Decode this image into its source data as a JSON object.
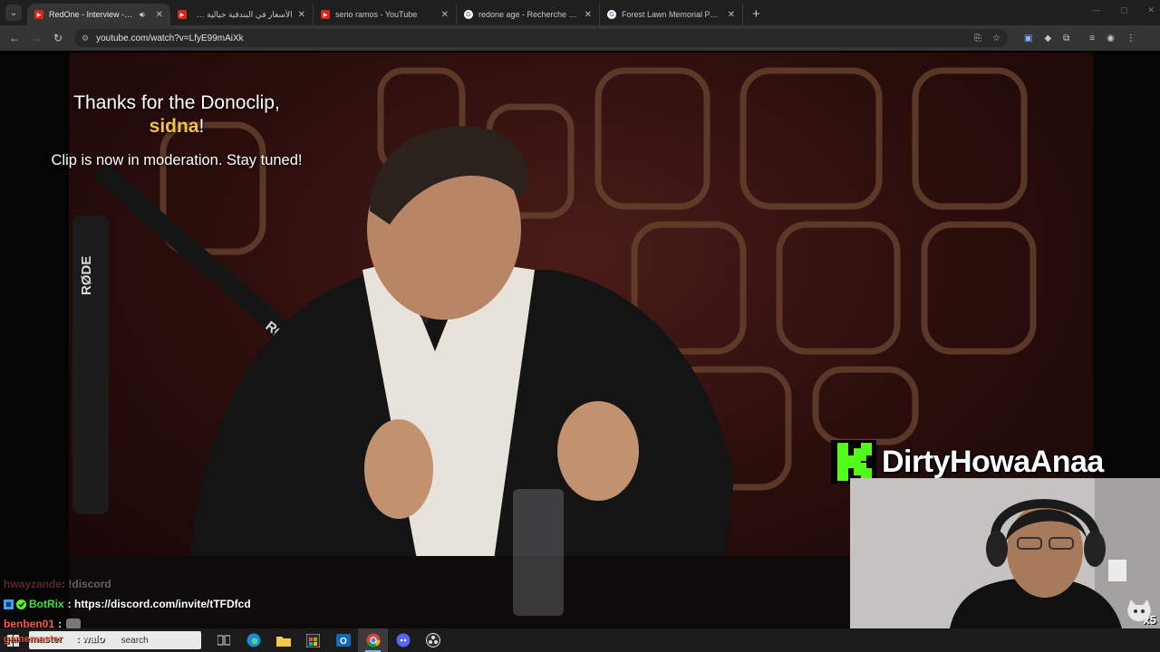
{
  "browser": {
    "tabs": [
      {
        "title": "RedOne - Interview - YouTube",
        "favicon": "youtube-icon",
        "active": true,
        "audio": true
      },
      {
        "title": "الأسعار في البندقية خيالية 🙂 جـ",
        "favicon": "youtube-icon",
        "active": false
      },
      {
        "title": "serio ramos - YouTube",
        "favicon": "youtube-icon",
        "active": false
      },
      {
        "title": "redone age - Recherche Google",
        "favicon": "google-icon",
        "active": false
      },
      {
        "title": "Forest Lawn Memorial Park – Google",
        "favicon": "google-icon",
        "active": false
      }
    ],
    "address": "youtube.com/watch?v=LfyE99mAiXk"
  },
  "overlay": {
    "donoclip_line1": "Thanks for the Donoclip,",
    "donoclip_name": "sidna",
    "donoclip_bang": "!",
    "donoclip_line2": "Clip is now in moderation. Stay tuned!",
    "streamer_name": "DirtyHowaAnaa",
    "emote_count": "x5"
  },
  "chat": [
    {
      "user": "hwayzande",
      "message": ": !discord",
      "faded": true
    },
    {
      "user": "BotRix",
      "message": ": https://discord.com/invite/tTFDfcd",
      "faded": false
    },
    {
      "user": "benben01",
      "message": ":",
      "faded": false
    },
    {
      "user": "gamemaster",
      "message": ": walo",
      "faded": false
    }
  ],
  "taskbar": {
    "search_placeholder": "search"
  },
  "colors": {
    "kick_green": "#53fc18",
    "donor_gold": "#f4c145",
    "youtube_red": "#e62117"
  }
}
